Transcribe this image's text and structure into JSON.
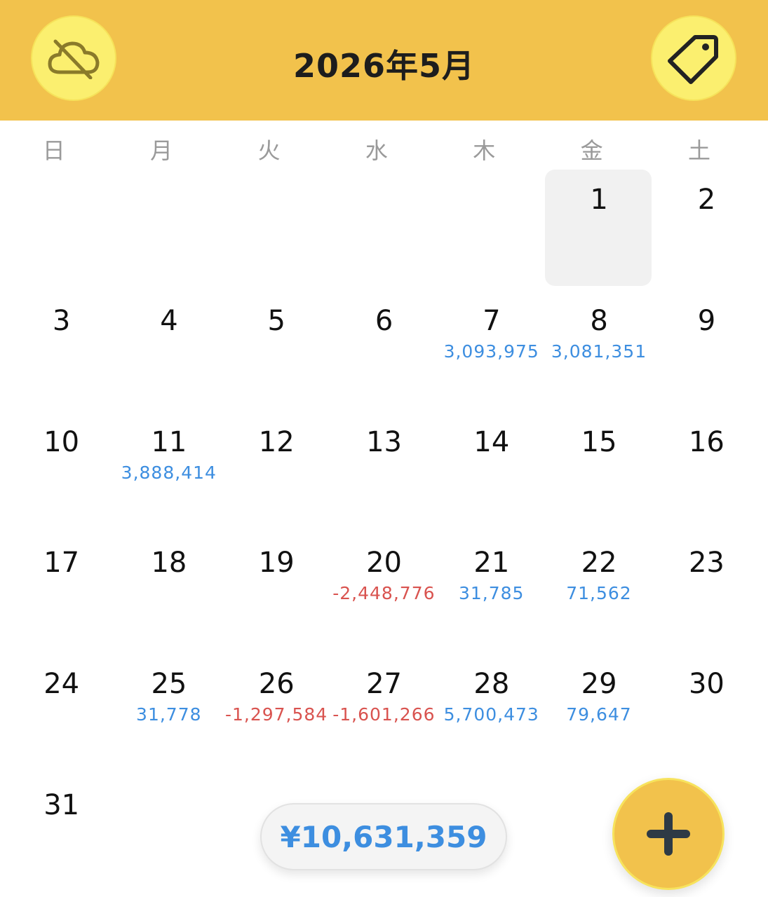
{
  "header": {
    "title": "2026年5月",
    "left_icon": "cloud-off-icon",
    "right_icon": "tag-icon"
  },
  "weekdays": [
    "日",
    "月",
    "火",
    "水",
    "木",
    "金",
    "土"
  ],
  "calendar": {
    "selected_day": "1",
    "cells": [
      {
        "day": "",
        "amount": "",
        "sign": ""
      },
      {
        "day": "",
        "amount": "",
        "sign": ""
      },
      {
        "day": "",
        "amount": "",
        "sign": ""
      },
      {
        "day": "",
        "amount": "",
        "sign": ""
      },
      {
        "day": "",
        "amount": "",
        "sign": ""
      },
      {
        "day": "1",
        "amount": "",
        "sign": ""
      },
      {
        "day": "2",
        "amount": "",
        "sign": ""
      },
      {
        "day": "3",
        "amount": "",
        "sign": ""
      },
      {
        "day": "4",
        "amount": "",
        "sign": ""
      },
      {
        "day": "5",
        "amount": "",
        "sign": ""
      },
      {
        "day": "6",
        "amount": "",
        "sign": ""
      },
      {
        "day": "7",
        "amount": "3,093,975",
        "sign": "pos"
      },
      {
        "day": "8",
        "amount": "3,081,351",
        "sign": "pos"
      },
      {
        "day": "9",
        "amount": "",
        "sign": ""
      },
      {
        "day": "10",
        "amount": "",
        "sign": ""
      },
      {
        "day": "11",
        "amount": "3,888,414",
        "sign": "pos"
      },
      {
        "day": "12",
        "amount": "",
        "sign": ""
      },
      {
        "day": "13",
        "amount": "",
        "sign": ""
      },
      {
        "day": "14",
        "amount": "",
        "sign": ""
      },
      {
        "day": "15",
        "amount": "",
        "sign": ""
      },
      {
        "day": "16",
        "amount": "",
        "sign": ""
      },
      {
        "day": "17",
        "amount": "",
        "sign": ""
      },
      {
        "day": "18",
        "amount": "",
        "sign": ""
      },
      {
        "day": "19",
        "amount": "",
        "sign": ""
      },
      {
        "day": "20",
        "amount": "-2,448,776",
        "sign": "neg"
      },
      {
        "day": "21",
        "amount": "31,785",
        "sign": "pos"
      },
      {
        "day": "22",
        "amount": "71,562",
        "sign": "pos"
      },
      {
        "day": "23",
        "amount": "",
        "sign": ""
      },
      {
        "day": "24",
        "amount": "",
        "sign": ""
      },
      {
        "day": "25",
        "amount": "31,778",
        "sign": "pos"
      },
      {
        "day": "26",
        "amount": "-1,297,584",
        "sign": "neg"
      },
      {
        "day": "27",
        "amount": "-1,601,266",
        "sign": "neg"
      },
      {
        "day": "28",
        "amount": "5,700,473",
        "sign": "pos"
      },
      {
        "day": "29",
        "amount": "79,647",
        "sign": "pos"
      },
      {
        "day": "30",
        "amount": "",
        "sign": ""
      },
      {
        "day": "31",
        "amount": "",
        "sign": ""
      }
    ]
  },
  "total": "¥10,631,359",
  "fab": {
    "icon": "plus-icon"
  },
  "colors": {
    "header": "#f2c24c",
    "button": "#fbef6f",
    "positive": "#3d8ee0",
    "negative": "#d9534f"
  }
}
